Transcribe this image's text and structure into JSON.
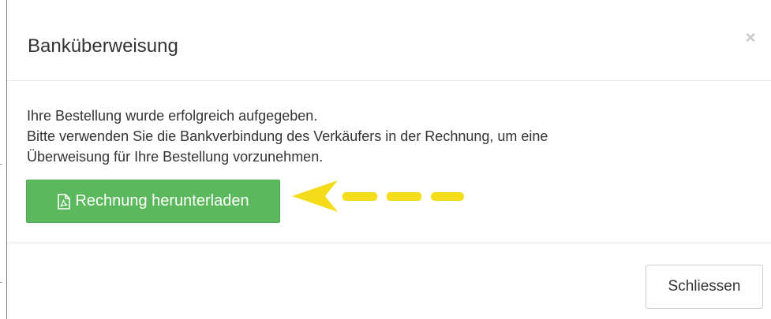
{
  "modal": {
    "title": "Banküberweisung",
    "close_icon": "close-icon",
    "close_glyph": "×"
  },
  "body": {
    "lines": [
      "Ihre Bestellung wurde erfolgreich aufgegeben.",
      "Bitte verwenden Sie die Bankverbindung des Verkäufers in der Rechnung, um eine",
      "Überweisung für Ihre Bestellung vorzunehmen."
    ],
    "download_button": {
      "label": "Rechnung herunterladen",
      "icon": "file-pdf-icon"
    },
    "annotation": {
      "type": "dashed-arrow",
      "color": "#f5dc1a",
      "points_to": "download_button"
    }
  },
  "footer": {
    "close_label": "Schliessen"
  },
  "colors": {
    "primary_button": "#5cb85c",
    "primary_button_text": "#ffffff",
    "text": "#333333",
    "divider": "#e5e5e5",
    "close_icon": "#c8c8c8",
    "annotation": "#f5dc1a"
  }
}
